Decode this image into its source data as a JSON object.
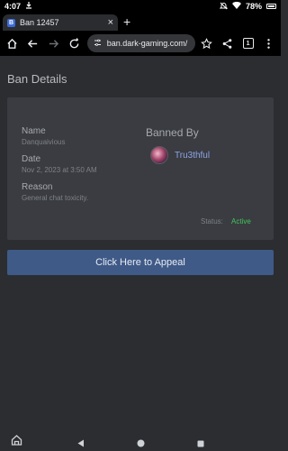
{
  "status_bar": {
    "time": "4:07",
    "battery": "78%"
  },
  "tab": {
    "favicon_letter": "B",
    "title": "Ban 12457"
  },
  "address_bar": {
    "url": "ban.dark-gaming.com/",
    "tab_count": "1"
  },
  "page": {
    "title": "Ban Details",
    "name_label": "Name",
    "name_value": "Danquaivious",
    "date_label": "Date",
    "date_value": "Nov 2, 2023 at 3:50 AM",
    "reason_label": "Reason",
    "reason_value": "General chat toxicity.",
    "banned_by_label": "Banned By",
    "banned_by_user": "Tru3thful",
    "status_label": "Status:",
    "status_value": "Active",
    "appeal_button": "Click Here to Appeal"
  },
  "colors": {
    "accent": "#8ea4e6",
    "status_active": "#43c45a",
    "button": "#3f5a87"
  }
}
